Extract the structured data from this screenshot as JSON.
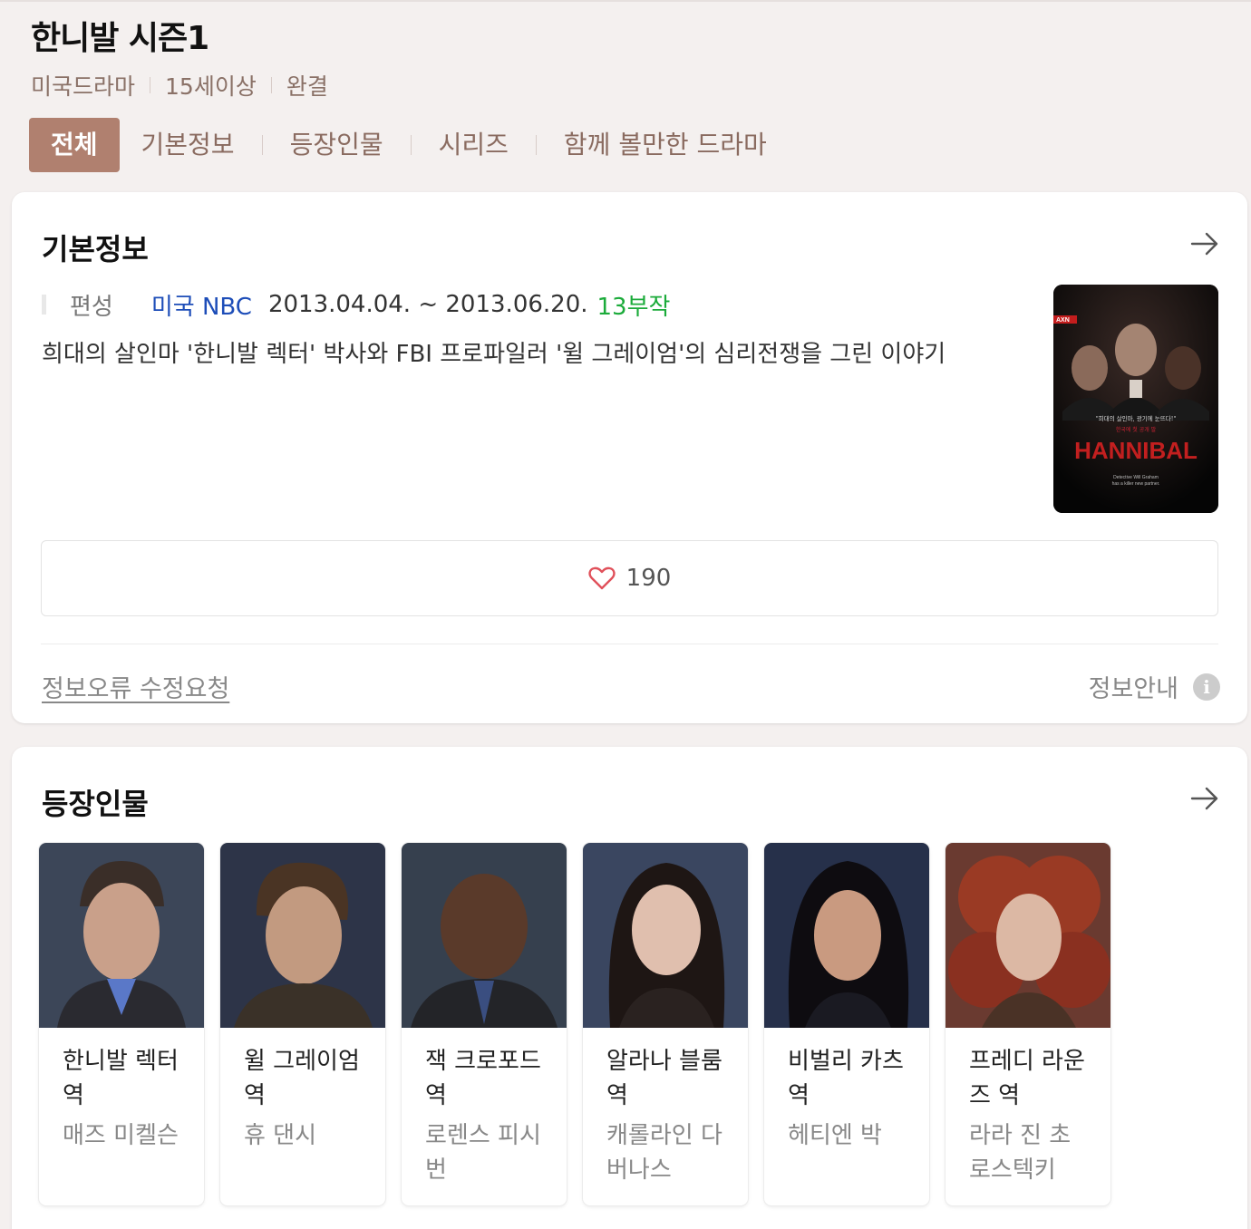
{
  "header": {
    "title": "한니발 시즌1",
    "meta": [
      "미국드라마",
      "15세이상",
      "완결"
    ]
  },
  "tabs": [
    {
      "label": "전체",
      "active": true
    },
    {
      "label": "기본정보",
      "active": false
    },
    {
      "label": "등장인물",
      "active": false
    },
    {
      "label": "시리즈",
      "active": false
    },
    {
      "label": "함께 볼만한 드라마",
      "active": false
    }
  ],
  "basic_info": {
    "heading": "기본정보",
    "label": "편성",
    "network": "미국 NBC",
    "dates": "2013.04.04. ~ 2013.06.20.",
    "episodes": "13부작",
    "description": "희대의 살인마 '한니발 렉터' 박사와 FBI 프로파일러 '윌 그레이엄'의 심리전쟁을 그린 이야기",
    "poster": {
      "channel_logo": "AXN",
      "tagline": "\"희대의 살인마, 광기에 눈뜨다!\"",
      "tagline2": "한국에 첫 공개 발",
      "title": "HANNIBAL",
      "small1": "Detective Will Graham",
      "small2": "has a killer new partner."
    },
    "likes": "190",
    "report_link": "정보오류 수정요청",
    "info_guide": "정보안내",
    "info_icon": "i"
  },
  "cast": {
    "heading": "등장인물",
    "members": [
      {
        "role": "한니발 렉터 역",
        "actor": "매즈 미켈슨"
      },
      {
        "role": "윌 그레이엄 역",
        "actor": "휴 댄시"
      },
      {
        "role": "잭 크로포드 역",
        "actor": "로렌스 피시번"
      },
      {
        "role": "알라나 블룸 역",
        "actor": "캐롤라인 다버나스"
      },
      {
        "role": "비벌리 카츠 역",
        "actor": "헤티엔 박"
      },
      {
        "role": "프레디 라운즈 역",
        "actor": "라라 진 초로스텍키"
      }
    ]
  },
  "colors": {
    "tab_active": "#b0806f",
    "network": "#1d4db8",
    "episodes": "#1bab3a",
    "heart": "#e0505a"
  }
}
